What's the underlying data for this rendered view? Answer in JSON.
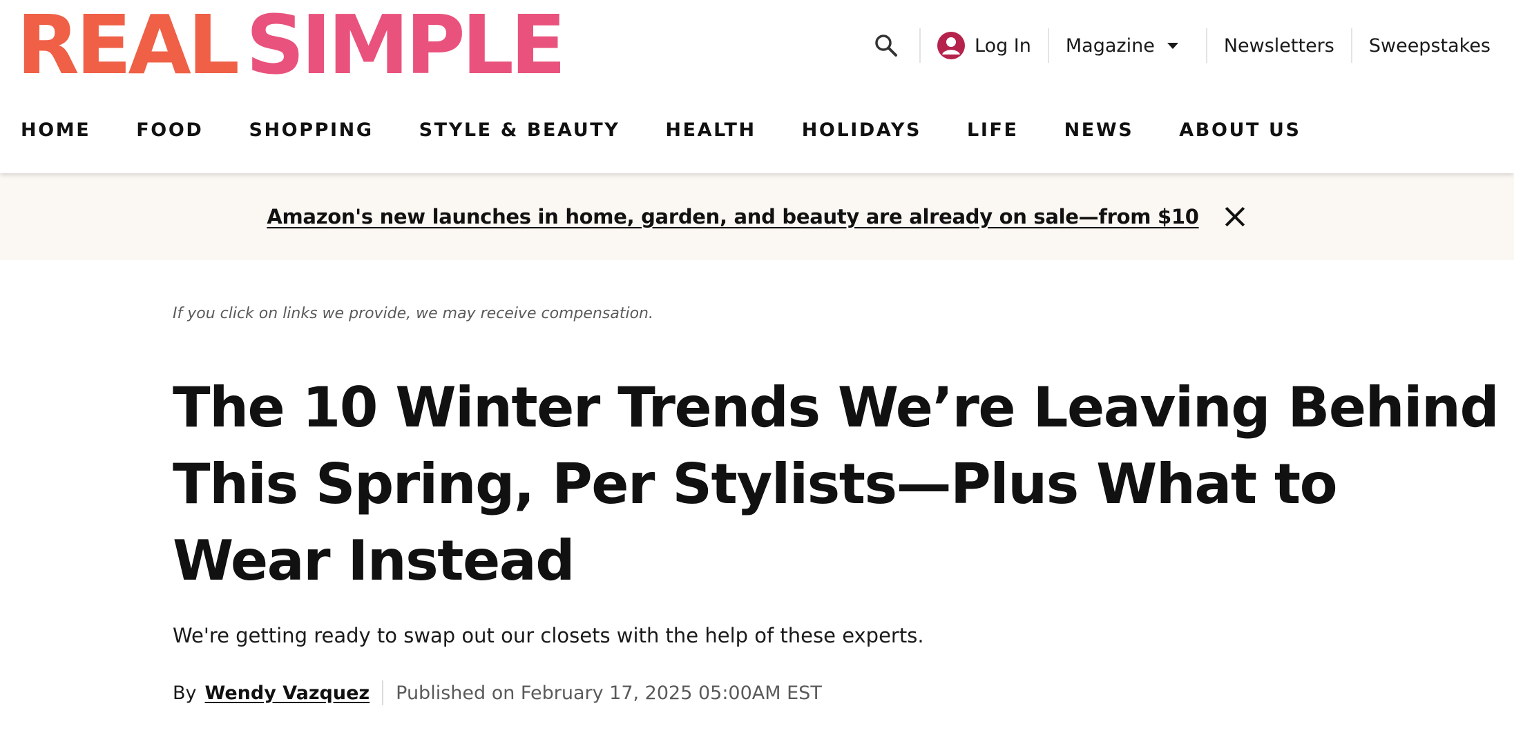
{
  "logo": {
    "word1": "REAL",
    "word2": "SIMPLE",
    "color1": "#ef6046",
    "color2": "#e9527c"
  },
  "utility_nav": {
    "search_icon": "search-icon",
    "login_label": "Log In",
    "login_icon": "user-avatar-icon",
    "login_icon_color": "#b5224c",
    "magazine_label": "Magazine",
    "magazine_icon": "caret-down-icon",
    "newsletters_label": "Newsletters",
    "sweepstakes_label": "Sweepstakes"
  },
  "main_nav": {
    "items": [
      {
        "label": "HOME"
      },
      {
        "label": "FOOD"
      },
      {
        "label": "SHOPPING"
      },
      {
        "label": "STYLE & BEAUTY"
      },
      {
        "label": "HEALTH"
      },
      {
        "label": "HOLIDAYS"
      },
      {
        "label": "LIFE"
      },
      {
        "label": "NEWS"
      },
      {
        "label": "ABOUT US"
      }
    ]
  },
  "promo_banner": {
    "text": "Amazon's new launches in home, garden, and beauty are already on sale—from $10",
    "close_icon": "close-icon",
    "background": "#fbf7f2"
  },
  "article": {
    "disclaimer": "If you click on links we provide, we may receive compensation.",
    "headline": "The 10 Winter Trends We’re Leaving Behind This Spring, Per Stylists—Plus What to Wear Instead",
    "dek": "We're getting ready to swap out our closets with the help of these experts.",
    "byline": {
      "by_label": "By",
      "author": "Wendy Vazquez",
      "published": "Published on February 17, 2025 05:00AM EST"
    }
  }
}
